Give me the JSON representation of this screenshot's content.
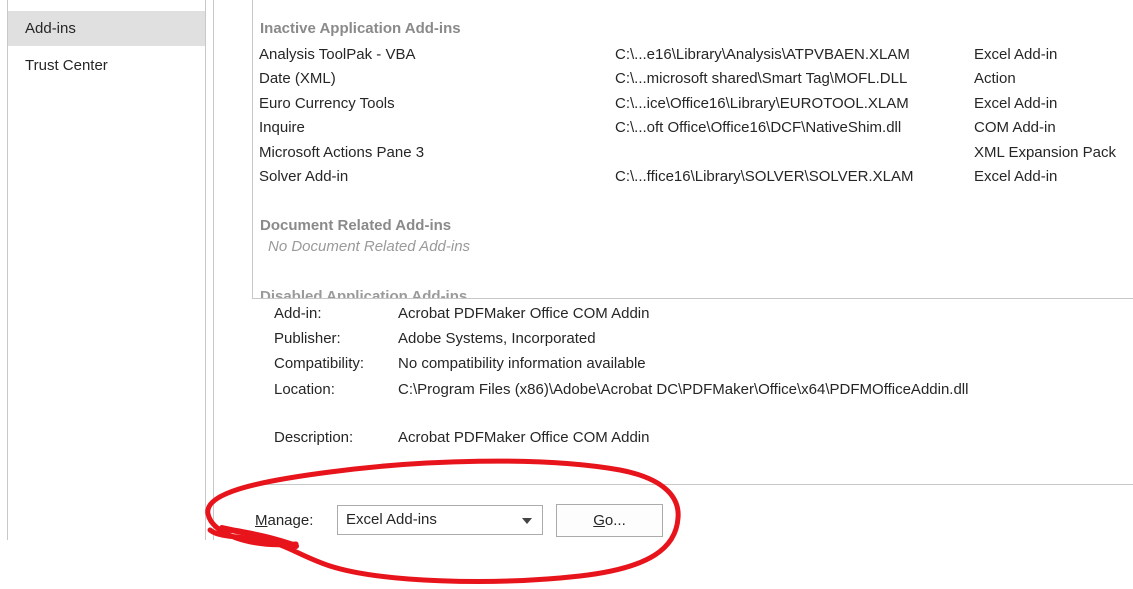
{
  "sidebar": {
    "items": [
      {
        "label": "Add-ins",
        "selected": true
      },
      {
        "label": "Trust Center",
        "selected": false
      }
    ]
  },
  "addins_list": {
    "inactive_header": "Inactive Application Add-ins",
    "inactive_rows": [
      {
        "name": "Analysis ToolPak - VBA",
        "location": "C:\\...e16\\Library\\Analysis\\ATPVBAEN.XLAM",
        "type": "Excel Add-in"
      },
      {
        "name": "Date (XML)",
        "location": "C:\\...microsoft shared\\Smart Tag\\MOFL.DLL",
        "type": "Action"
      },
      {
        "name": "Euro Currency Tools",
        "location": "C:\\...ice\\Office16\\Library\\EUROTOOL.XLAM",
        "type": "Excel Add-in"
      },
      {
        "name": "Inquire",
        "location": "C:\\...oft Office\\Office16\\DCF\\NativeShim.dll",
        "type": "COM Add-in"
      },
      {
        "name": "Microsoft Actions Pane 3",
        "location": "",
        "type": "XML Expansion Pack"
      },
      {
        "name": "Solver Add-in",
        "location": "C:\\...ffice16\\Library\\SOLVER\\SOLVER.XLAM",
        "type": "Excel Add-in"
      }
    ],
    "document_header": "Document Related Add-ins",
    "document_empty": "No Document Related Add-ins",
    "disabled_header": "Disabled Application Add-ins"
  },
  "details": {
    "addin_label": "Add-in:",
    "addin_value": "Acrobat PDFMaker Office COM Addin",
    "publisher_label": "Publisher:",
    "publisher_value": "Adobe Systems, Incorporated",
    "compat_label": "Compatibility:",
    "compat_value": "No compatibility information available",
    "location_label": "Location:",
    "location_value": "C:\\Program Files (x86)\\Adobe\\Acrobat DC\\PDFMaker\\Office\\x64\\PDFMOfficeAddin.dll",
    "description_label": "Description:",
    "description_value": "Acrobat PDFMaker Office COM Addin"
  },
  "manage": {
    "label_accel": "M",
    "label_rest": "anage:",
    "selected": "Excel Add-ins",
    "go_accel": "G",
    "go_rest": "o..."
  },
  "colors": {
    "annotation": "#e8141c",
    "selected_nav_bg": "#e0e0e0",
    "header_gray": "#8a8a8a"
  }
}
